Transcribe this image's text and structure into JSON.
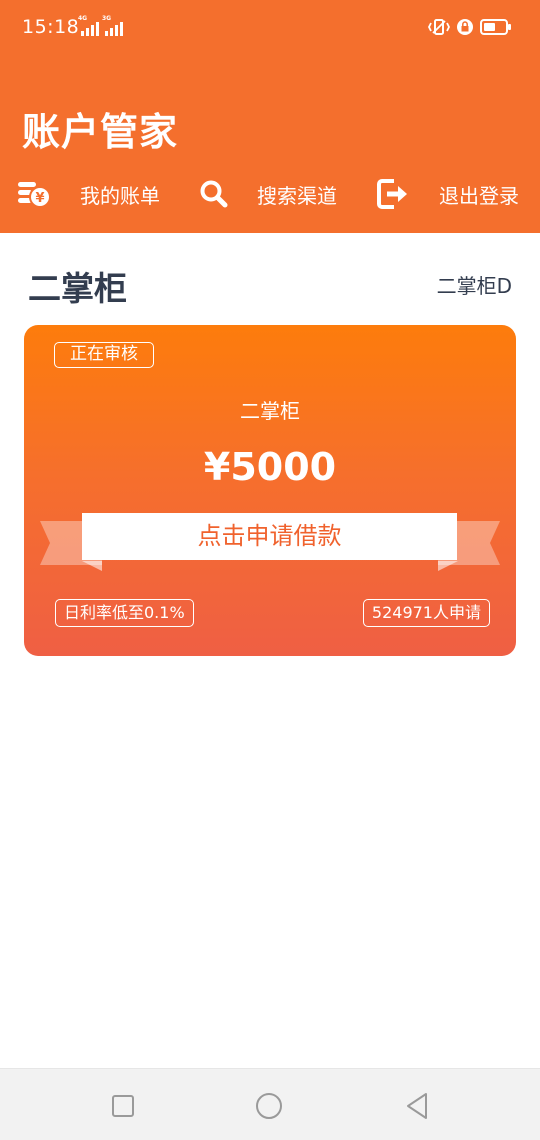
{
  "status_bar": {
    "time": "15:18",
    "signal1_tag": "4G",
    "signal2_tag": "3G"
  },
  "header": {
    "title": "账户管家",
    "nav": [
      {
        "label": "我的账单",
        "icon": "bill-coin-icon"
      },
      {
        "label": "搜索渠道",
        "icon": "search-icon"
      },
      {
        "label": "退出登录",
        "icon": "logout-icon"
      }
    ]
  },
  "section": {
    "title": "二掌柜",
    "subtitle": "二掌柜D"
  },
  "card": {
    "status_badge": "正在审核",
    "name": "二掌柜",
    "amount": "¥5000",
    "apply_button": "点击申请借款",
    "rate_text": "日利率低至0.1%",
    "apply_count_text": "524971人申请"
  },
  "colors": {
    "header_bg": "#f46f2d",
    "card_top": "#fd7c0c",
    "card_bottom": "#ef5f44",
    "button_text": "#f0622d",
    "title_text": "#333d4f"
  },
  "system_nav": {
    "icons": [
      "recent-apps-icon",
      "home-icon",
      "back-icon"
    ]
  }
}
